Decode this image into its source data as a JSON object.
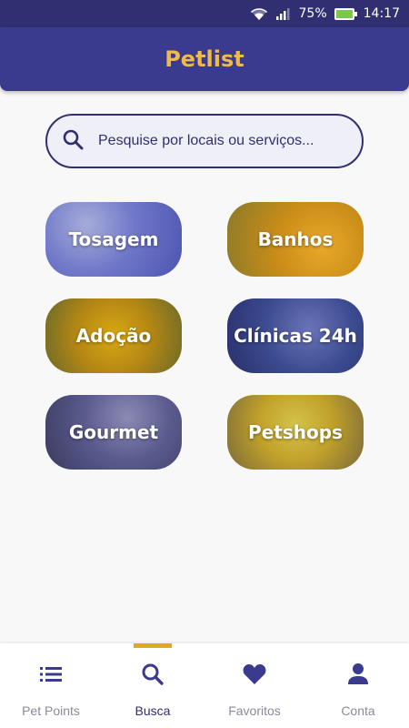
{
  "status_bar": {
    "battery": "75%",
    "time": "14:17"
  },
  "app_bar": {
    "title": "Petlist"
  },
  "search": {
    "placeholder": "Pesquise por locais ou serviços..."
  },
  "categories": [
    {
      "label": "Tosagem"
    },
    {
      "label": "Banhos"
    },
    {
      "label": "Adoção"
    },
    {
      "label": "Clínicas 24h"
    },
    {
      "label": "Gourmet"
    },
    {
      "label": "Petshops"
    }
  ],
  "bottom_nav": {
    "items": [
      {
        "label": "Pet Points",
        "icon": "list-icon"
      },
      {
        "label": "Busca",
        "icon": "search-icon",
        "active": true
      },
      {
        "label": "Favoritos",
        "icon": "heart-icon"
      },
      {
        "label": "Conta",
        "icon": "person-icon"
      }
    ]
  },
  "colors": {
    "primary": "#3a3a8e",
    "accent": "#f0b94a",
    "indicator": "#e0a81e"
  }
}
